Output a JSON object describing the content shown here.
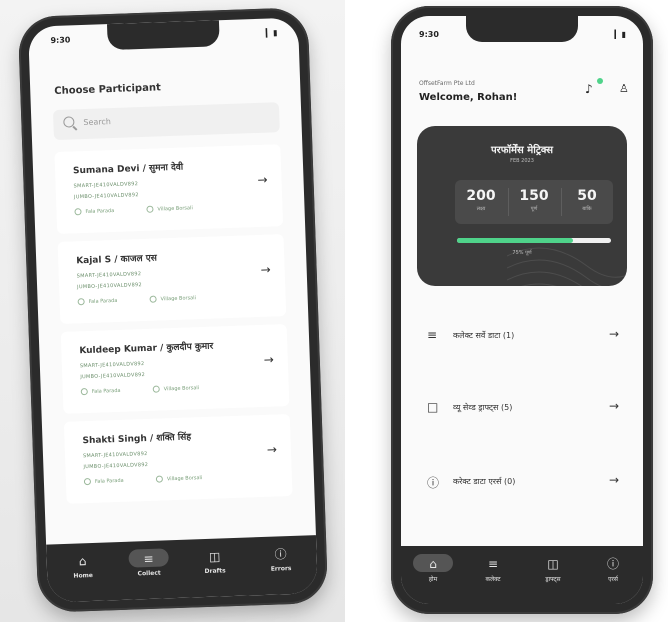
{
  "left_phone": {
    "status_time": "9:30",
    "status_icons": "▎▮",
    "title": "Choose Participant",
    "search_placeholder": "Search",
    "participants": [
      {
        "name": "Sumana Devi / सुमना देवी",
        "code1": "SMART-JE410VALDV892",
        "code2": "JUMBO-JE410VALDV892",
        "loc1": "Fala Parada",
        "loc2": "Village Borsali"
      },
      {
        "name": "Kajal S / काजल एस",
        "code1": "SMART-JE410VALDV892",
        "code2": "JUMBO-JE410VALDV892",
        "loc1": "Fala Parada",
        "loc2": "Village Borsali"
      },
      {
        "name": "Kuldeep Kumar / कुलदीप कुमार",
        "code1": "SMART-JE410VALDV892",
        "code2": "JUMBO-JE410VALDV892",
        "loc1": "Fala Parada",
        "loc2": "Village Borsali"
      },
      {
        "name": "Shakti Singh / शक्ति सिंह",
        "code1": "SMART-JE410VALDV892",
        "code2": "JUMBO-JE410VALDV892",
        "loc1": "Fala Parada",
        "loc2": "Village Borsali"
      }
    ],
    "nav": [
      "Home",
      "Collect",
      "Drafts",
      "Errors"
    ]
  },
  "right_phone": {
    "status_time": "9:30",
    "status_icons": "▎▮",
    "company": "OffsetFarm Pte Ltd",
    "welcome": "Welcome, Rohan!",
    "card": {
      "title": "परफॉर्मेंस मेट्रिक्स",
      "date": "FEB 2023",
      "stats": [
        {
          "value": "200",
          "label": "लक्ष्य"
        },
        {
          "value": "150",
          "label": "पूर्ण"
        },
        {
          "value": "50",
          "label": "बाकि"
        }
      ],
      "progress_percent": 75,
      "progress_label": "75% पूर्ण"
    },
    "menu": [
      {
        "icon": "≡",
        "label": "कलेक्ट सर्वे डाटा (1)"
      },
      {
        "icon": "□",
        "label": "व्यू सेव्ड ड्राफ्ट्स (5)"
      },
      {
        "icon": "ⓘ",
        "label": "करेक्ट डाटा एरर्स (0)"
      }
    ],
    "nav": [
      "होम",
      "कलेक्ट",
      "ड्राफ्ट्स",
      "एरर्स"
    ]
  },
  "colors": {
    "accent_green": "#4fd38a",
    "dark": "#2b2b2b",
    "card": "#3a3a3a"
  }
}
